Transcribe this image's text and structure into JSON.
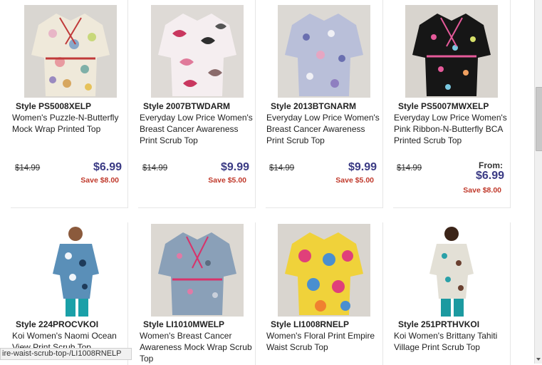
{
  "products": [
    {
      "style": "Style PS5008XELP",
      "desc": "Women's Puzzle-N-Butterfly Mock Wrap Printed Top",
      "was": "$14.99",
      "from": "",
      "price": "$6.99",
      "save": "Save $8.00"
    },
    {
      "style": "Style 2007BTWDARM",
      "desc": "Everyday Low Price Women's Breast Cancer Awareness Print Scrub Top",
      "was": "$14.99",
      "from": "",
      "price": "$9.99",
      "save": "Save $5.00"
    },
    {
      "style": "Style 2013BTGNARM",
      "desc": "Everyday Low Price Women's Breast Cancer Awareness Print Scrub Top",
      "was": "$14.99",
      "from": "",
      "price": "$9.99",
      "save": "Save $5.00"
    },
    {
      "style": "Style PS5007MWXELP",
      "desc": "Everyday Low Price Women's Pink Ribbon-N-Butterfly BCA Printed Scrub Top",
      "was": "$14.99",
      "from": "From:",
      "price": "$6.99",
      "save": "Save $8.00"
    },
    {
      "style": "Style 224PROCVKOI",
      "desc": "Koi Women's Naomi Ocean View Print Scrub Top",
      "was": "",
      "from": "",
      "price": "",
      "save": ""
    },
    {
      "style": "Style LI1010MWELP",
      "desc": "Women's Breast Cancer Awareness Mock Wrap Scrub Top",
      "was": "",
      "from": "",
      "price": "",
      "save": ""
    },
    {
      "style": "Style LI1008RNELP",
      "desc": "Women's Floral Print Empire Waist Scrub Top",
      "was": "",
      "from": "",
      "price": "",
      "save": ""
    },
    {
      "style": "Style 251PRTHVKOI",
      "desc": "Koi Women's Brittany Tahiti Village Print Scrub Top",
      "was": "",
      "from": "",
      "price": "",
      "save": ""
    }
  ],
  "status_url": "ire-waist-scrub-top-/LI1008RNELP"
}
